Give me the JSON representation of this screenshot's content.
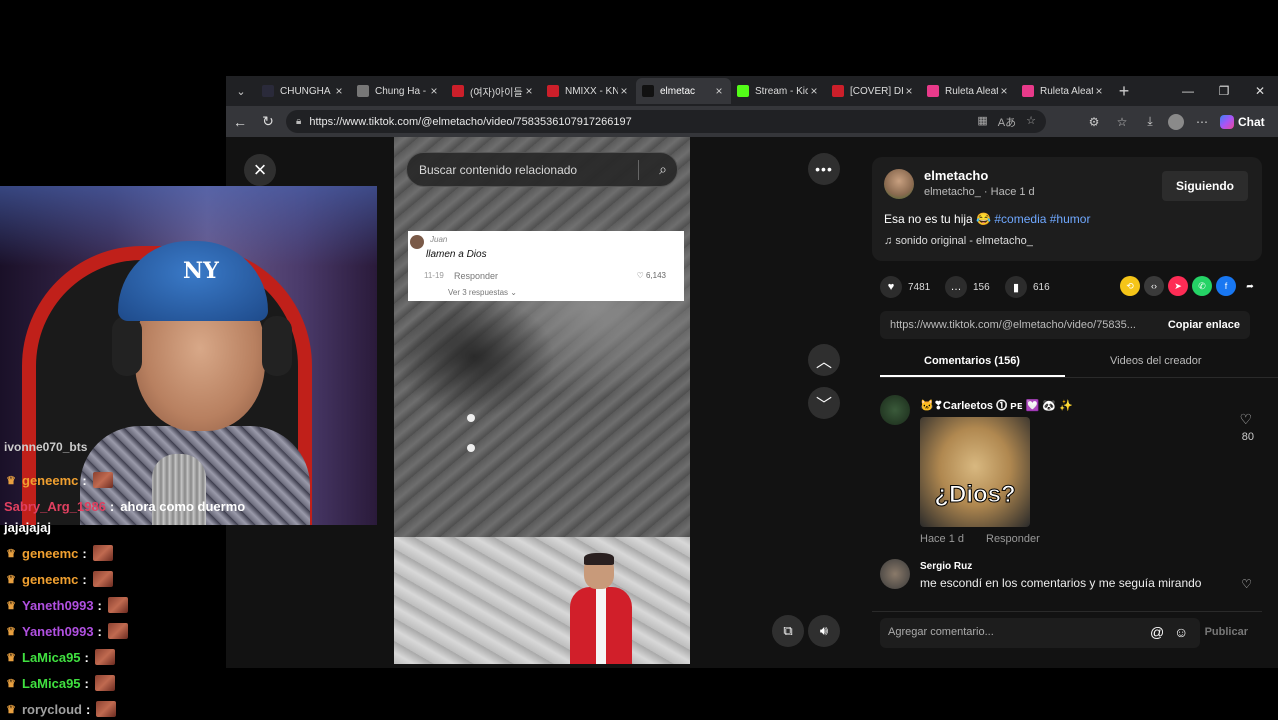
{
  "browser": {
    "tabs": [
      {
        "label": "CHUNGHA -",
        "fav_color": "#2a2a3a",
        "active": false
      },
      {
        "label": "Chung Ha -",
        "fav_color": "#777777",
        "active": false
      },
      {
        "label": "(여자)아이들",
        "fav_color": "#cc1f2a",
        "active": false
      },
      {
        "label": "NMIXX - KN",
        "fav_color": "#cc1f2a",
        "active": false
      },
      {
        "label": "elmetac",
        "fav_color": "#111111",
        "active": true
      },
      {
        "label": "Stream - Kic",
        "fav_color": "#53fc18",
        "active": false
      },
      {
        "label": "[COVER] DK",
        "fav_color": "#cc1f2a",
        "active": false
      },
      {
        "label": "Ruleta Aleat",
        "fav_color": "#e83a8a",
        "active": false
      },
      {
        "label": "Ruleta Aleat",
        "fav_color": "#e83a8a",
        "active": false
      }
    ],
    "url": "https://www.tiktok.com/@elmetacho/video/7583536107917266197",
    "chat_label": "Chat"
  },
  "video": {
    "search_placeholder": "Buscar contenido relacionado",
    "comment_card": {
      "name": "Juan",
      "text": "llamen a Dios",
      "date": "11-19",
      "reply": "Responder",
      "likes": "6,143",
      "more": "Ver 3 respuestas"
    }
  },
  "post": {
    "username": "elmetacho",
    "subline": "elmetacho_ · Hace 1 d",
    "follow_label": "Siguiendo",
    "caption": "Esa no es tu hija",
    "hashtags": [
      "#comedia",
      "#humor"
    ],
    "sound": "sonido original - elmetacho_",
    "likes": "7481",
    "comments": "156",
    "saves": "616",
    "share_colors": [
      "#f5c518",
      "#3a3a3a",
      "#fe2c55",
      "#25d366",
      "#1877f2"
    ],
    "link": "https://www.tiktok.com/@elmetacho/video/75835...",
    "copy_label": "Copiar enlace",
    "tab_comments": "Comentarios (156)",
    "tab_creator": "Videos del creador",
    "comment1": {
      "name": "🐱❣Carleetos ⓵ ᴘᴇ 💟 🐼 ✨",
      "image_text": "¿Dios?",
      "date": "Hace 1 d",
      "reply": "Responder",
      "likes": "80"
    },
    "comment2": {
      "name": "Sergio Ruz",
      "text": "me escondí en los comentarios y me seguía mirando"
    },
    "add_comment_placeholder": "Agregar comentario...",
    "post_label": "Publicar"
  },
  "stream_chat": {
    "top_fragment": "ivonne070_bts",
    "lines": [
      {
        "user": "geneemc",
        "color": "#f0a030",
        "msg": "",
        "emote": true
      },
      {
        "user": "Sabry_Arg_1986",
        "color": "#e04060",
        "msg": "ahora como duermo",
        "emote": false
      },
      {
        "user": "",
        "color": "#ffffff",
        "msg": "jajajajaj",
        "emote": false
      },
      {
        "user": "geneemc",
        "color": "#f0a030",
        "msg": "",
        "emote": true
      },
      {
        "user": "geneemc",
        "color": "#f0a030",
        "msg": "",
        "emote": true
      },
      {
        "user": "Yaneth0993",
        "color": "#b050e0",
        "msg": "",
        "emote": true
      },
      {
        "user": "Yaneth0993",
        "color": "#b050e0",
        "msg": "",
        "emote": true
      },
      {
        "user": "LaMica95",
        "color": "#40e040",
        "msg": "",
        "emote": true
      },
      {
        "user": "LaMica95",
        "color": "#40e040",
        "msg": "",
        "emote": true
      },
      {
        "user": "rorycloud",
        "color": "#a0a0a0",
        "msg": "",
        "emote": true
      }
    ]
  }
}
